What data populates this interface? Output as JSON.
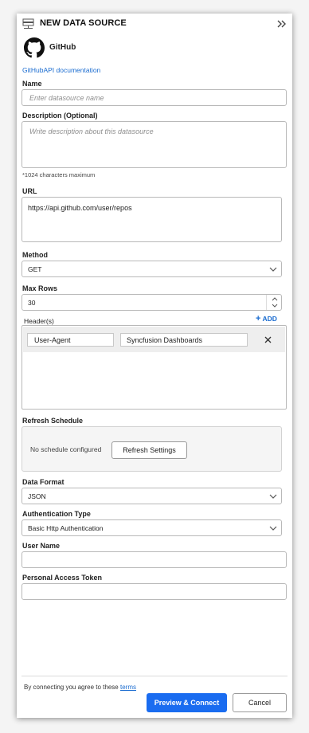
{
  "header": {
    "title": "NEW DATA SOURCE",
    "collapse_icon": "double-chevron-right-icon"
  },
  "source": {
    "name": "GitHub",
    "doc_link": "GitHubAPI documentation"
  },
  "form": {
    "name_label": "Name",
    "name_placeholder": "Enter datasource name",
    "description_label": "Description (Optional)",
    "description_placeholder": "Write description about this datasource",
    "description_note": "*1024 characters maximum",
    "url_label": "URL",
    "url_value": "https://api.github.com/user/repos",
    "method_label": "Method",
    "method_value": "GET",
    "max_rows_label": "Max Rows",
    "max_rows_value": "30",
    "headers_label": "Header(s)",
    "add_label": "ADD",
    "headers": [
      {
        "key": "User-Agent",
        "value": "Syncfusion Dashboards"
      }
    ],
    "refresh_label": "Refresh Schedule",
    "refresh_status": "No schedule configured",
    "refresh_button": "Refresh Settings",
    "format_label": "Data Format",
    "format_value": "JSON",
    "auth_label": "Authentication Type",
    "auth_value": "Basic Http Authentication",
    "user_label": "User Name",
    "user_value": "",
    "token_label": "Personal Access Token",
    "token_value": ""
  },
  "footer": {
    "terms_prefix": "By connecting you agree to these",
    "terms_link": "terms",
    "primary_button": "Preview & Connect",
    "cancel_button": "Cancel"
  },
  "colors": {
    "primary": "#1a6cf0",
    "link": "#1a6cd0"
  }
}
